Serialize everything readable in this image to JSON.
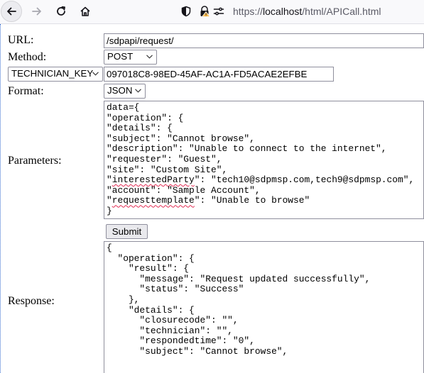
{
  "browser": {
    "url_prefix": "https://",
    "url_host": "localhost",
    "url_path": "/html/APICall.html",
    "icons": [
      "back-arrow-icon",
      "forward-arrow-icon",
      "reload-icon",
      "home-icon",
      "shield-icon",
      "lock-warning-icon",
      "permissions-icon"
    ]
  },
  "form": {
    "url_label": "URL:",
    "url_value": "/sdpapi/request/",
    "method_label": "Method:",
    "method_value": "POST",
    "key_select": "TECHNICIAN_KEY",
    "key_value": "097018C8-98ED-45AF-AC1A-FD5ACAE2EFBE",
    "format_label": "Format:",
    "format_value": "JSON",
    "parameters_label": "Parameters:",
    "parameters_lines": [
      "data={",
      "\"operation\": {",
      "\"details\": {",
      "\"subject\": \"Cannot browse\",",
      "\"description\": \"Unable to connect to the internet\",",
      "\"requester\": \"Guest\",",
      "\"site\": \"Custom Site\",",
      "\"interestedParty\": \"tech10@sdpmsp.com,tech9@sdpmsp.com\",",
      "\"account\": \"Sample Account\",",
      "\"requesttemplate\": \"Unable to browse\"",
      "}"
    ],
    "submit_label": "Submit",
    "response_label": "Response:",
    "response_lines": [
      "{",
      "  \"operation\": {",
      "    \"result\": {",
      "      \"message\": \"Request updated successfully\",",
      "      \"status\": \"Success\"",
      "    },",
      "    \"details\": {",
      "      \"closurecode\": \"\",",
      "      \"technician\": \"\",",
      "      \"respondedtime\": \"0\",",
      "      \"subject\": \"Cannot browse\","
    ]
  }
}
